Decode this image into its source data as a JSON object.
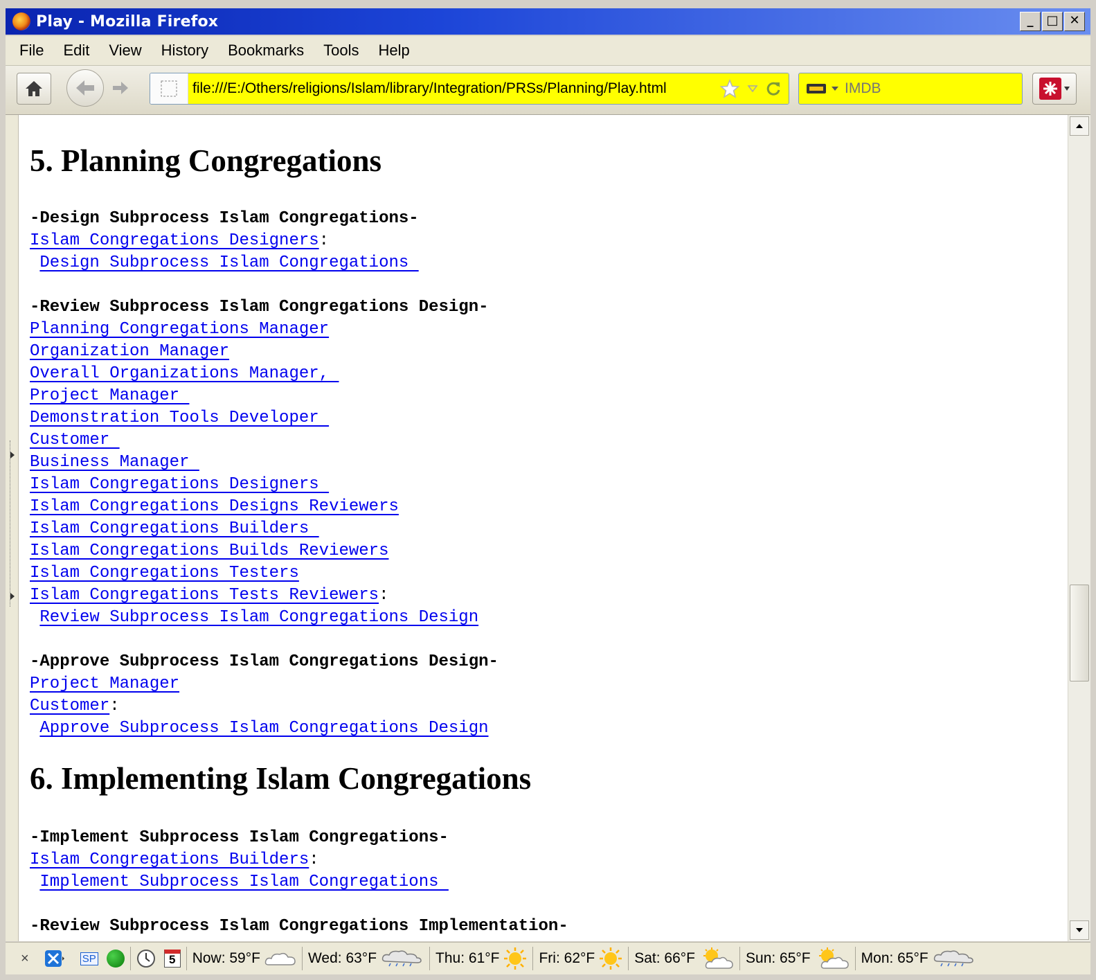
{
  "window": {
    "title": "Play - Mozilla Firefox",
    "controls": [
      "_",
      "□",
      "✕"
    ]
  },
  "menu": [
    {
      "label": "File"
    },
    {
      "label": "Edit"
    },
    {
      "label": "View"
    },
    {
      "label": "History"
    },
    {
      "label": "Bookmarks"
    },
    {
      "label": "Tools"
    },
    {
      "label": "Help"
    }
  ],
  "nav": {
    "url": "file:///E:/Others/religions/Islam/library/Integration/PRSs/Planning/Play.html",
    "search_placeholder": "IMDB",
    "highlight_color": "#ffff00"
  },
  "page": {
    "sections": [
      {
        "heading": "5. Planning Congregations",
        "steps": [
          {
            "title": "-Design Subprocess Islam Congregations-",
            "roles": [
              "Islam Congregations Designers"
            ],
            "action": "Design Subprocess Islam Congregations "
          },
          {
            "title": "-Review Subprocess Islam Congregations Design-",
            "roles": [
              "Planning Congregations Manager",
              "Organization Manager",
              "Overall Organizations Manager, ",
              "Project Manager ",
              "Demonstration Tools Developer ",
              "Customer ",
              "Business Manager ",
              "Islam Congregations Designers ",
              "Islam Congregations Designs Reviewers",
              "Islam Congregations Builders ",
              "Islam Congregations Builds Reviewers",
              "Islam Congregations Testers",
              "Islam Congregations Tests Reviewers"
            ],
            "action": "Review Subprocess Islam Congregations Design"
          },
          {
            "title": "-Approve Subprocess Islam Congregations Design-",
            "roles": [
              "Project Manager",
              "Customer"
            ],
            "action": "Approve Subprocess Islam Congregations Design"
          }
        ]
      },
      {
        "heading": "6. Implementing Islam Congregations",
        "steps": [
          {
            "title": "-Implement Subprocess Islam Congregations-",
            "roles": [
              "Islam Congregations Builders"
            ],
            "action": "Implement Subprocess Islam Congregations "
          },
          {
            "title": "-Review Subprocess Islam Congregations Implementation-"
          }
        ]
      }
    ]
  },
  "statusbar": {
    "close": "×",
    "sp": "SP",
    "calendar_day": "5",
    "weather": [
      {
        "label": "Now: 59°F",
        "icon": "cloud-icon"
      },
      {
        "label": "Wed: 63°F",
        "icon": "rain-cloud-icon"
      },
      {
        "label": "Thu: 61°F",
        "icon": "sun-icon"
      },
      {
        "label": "Fri: 62°F",
        "icon": "sun-icon"
      },
      {
        "label": "Sat: 66°F",
        "icon": "partly-cloudy-icon"
      },
      {
        "label": "Sun: 65°F",
        "icon": "partly-cloudy-icon"
      },
      {
        "label": "Mon: 65°F",
        "icon": "rain-cloud-icon"
      }
    ]
  }
}
